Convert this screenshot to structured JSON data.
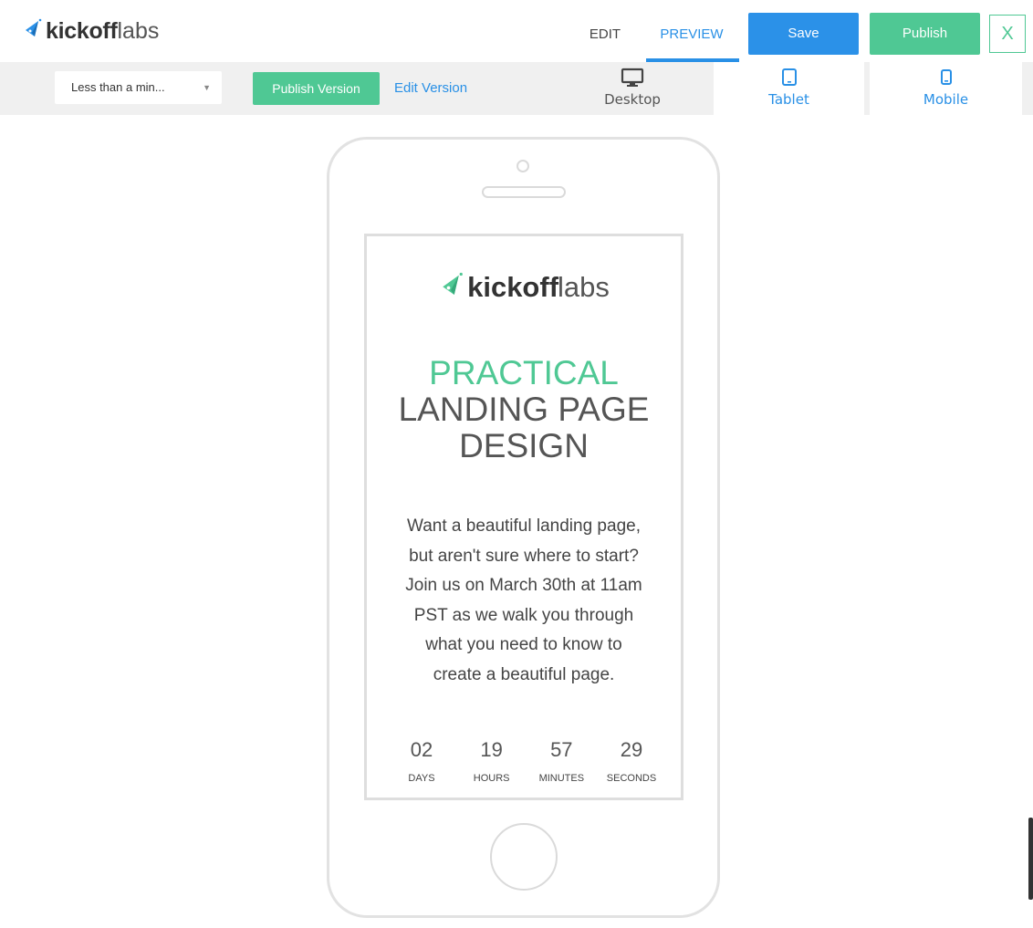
{
  "header": {
    "brand_bold": "kickoff",
    "brand_light": "labs",
    "tabs": [
      {
        "label": "EDIT",
        "active": false
      },
      {
        "label": "PREVIEW",
        "active": true
      }
    ],
    "save_label": "Save",
    "publish_label": "Publish",
    "close_label": "X"
  },
  "toolbar": {
    "version_select": {
      "value": "Less than a min...",
      "arrow": "▼"
    },
    "publish_version_label": "Publish Version",
    "edit_version_label": "Edit Version",
    "devices": [
      {
        "label": "Desktop",
        "icon": "desktop-icon"
      },
      {
        "label": "Tablet",
        "icon": "tablet-icon"
      },
      {
        "label": "Mobile",
        "icon": "mobile-icon"
      }
    ]
  },
  "preview": {
    "brand_bold": "kickoff",
    "brand_light": "labs",
    "headline_accent": "PRACTICAL",
    "headline_line2": "LANDING PAGE",
    "headline_line3": "DESIGN",
    "body_lines": [
      "Want a beautiful landing page,",
      "but aren't sure where to start?",
      "Join us on March 30th at 11am",
      "PST as we walk you through",
      "what you need to know to",
      "create a beautiful page."
    ],
    "countdown": [
      {
        "value": "02",
        "label": "DAYS"
      },
      {
        "value": "19",
        "label": "HOURS"
      },
      {
        "value": "57",
        "label": "MINUTES"
      },
      {
        "value": "29",
        "label": "SECONDS"
      }
    ]
  },
  "colors": {
    "accent_blue": "#2b91e8",
    "accent_green": "#4fc894"
  }
}
